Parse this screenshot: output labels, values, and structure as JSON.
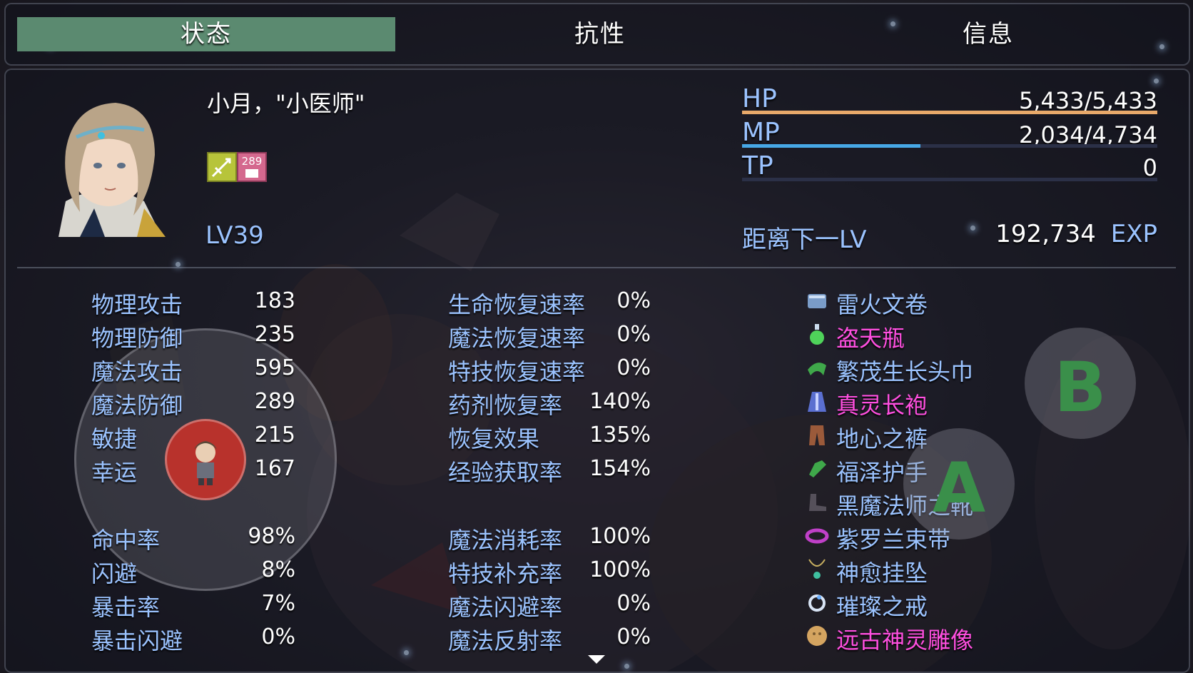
{
  "tabs": [
    {
      "label": "状态",
      "active": true
    },
    {
      "label": "抗性",
      "active": false
    },
    {
      "label": "信息",
      "active": false
    }
  ],
  "character": {
    "name": "小月，\"小医师\"",
    "state_badge": "289",
    "level": "LV39"
  },
  "gauges": {
    "hp": {
      "label": "HP",
      "value": "5,433/5,433",
      "fill": 1.0,
      "color": "#e8a96a"
    },
    "mp": {
      "label": "MP",
      "value": "2,034/4,734",
      "fill": 0.43,
      "color": "#47a8e6"
    },
    "tp": {
      "label": "TP",
      "value": "0",
      "fill": 0.0,
      "color": "#6b7cc8"
    }
  },
  "exp": {
    "label": "距离下一LV",
    "value": "192,734",
    "unit": "EXP"
  },
  "base_stats": [
    {
      "label": "物理攻击",
      "value": "183"
    },
    {
      "label": "物理防御",
      "value": "235"
    },
    {
      "label": "魔法攻击",
      "value": "595"
    },
    {
      "label": "魔法防御",
      "value": "289"
    },
    {
      "label": "敏捷",
      "value": "215"
    },
    {
      "label": "幸运",
      "value": "167"
    }
  ],
  "rate_stats": [
    {
      "label": "命中率",
      "value": "98%"
    },
    {
      "label": "闪避",
      "value": "8%"
    },
    {
      "label": "暴击率",
      "value": "7%"
    },
    {
      "label": "暴击闪避",
      "value": "0%"
    }
  ],
  "recovery_stats": [
    {
      "label": "生命恢复速率",
      "value": "0%"
    },
    {
      "label": "魔法恢复速率",
      "value": "0%"
    },
    {
      "label": "特技恢复速率",
      "value": "0%"
    },
    {
      "label": "药剂恢复率",
      "value": "140%"
    },
    {
      "label": "恢复效果",
      "value": "135%"
    },
    {
      "label": "经验获取率",
      "value": "154%"
    }
  ],
  "special_stats": [
    {
      "label": "魔法消耗率",
      "value": "100%"
    },
    {
      "label": "特技补充率",
      "value": "100%"
    },
    {
      "label": "魔法闪避率",
      "value": "0%"
    },
    {
      "label": "魔法反射率",
      "value": "0%"
    }
  ],
  "equipment": [
    {
      "name": "雷火文卷",
      "color": "#9bc3ff",
      "icon": "scroll-icon"
    },
    {
      "name": "盗天瓶",
      "color": "#ff4fe0",
      "icon": "potion-icon"
    },
    {
      "name": "繁茂生长头巾",
      "color": "#9bc3ff",
      "icon": "headband-icon"
    },
    {
      "name": "真灵长袍",
      "color": "#ff4fe0",
      "icon": "robe-icon"
    },
    {
      "name": "地心之裤",
      "color": "#9bc3ff",
      "icon": "pants-icon"
    },
    {
      "name": "福泽护手",
      "color": "#9bc3ff",
      "icon": "gauntlet-icon"
    },
    {
      "name": "黑魔法师之靴",
      "color": "#9bc3ff",
      "icon": "boots-icon"
    },
    {
      "name": "紫罗兰束带",
      "color": "#9bc3ff",
      "icon": "belt-icon"
    },
    {
      "name": "神愈挂坠",
      "color": "#9bc3ff",
      "icon": "pendant-icon"
    },
    {
      "name": "璀璨之戒",
      "color": "#9bc3ff",
      "icon": "ring-icon"
    },
    {
      "name": "远古神灵雕像",
      "color": "#ff4fe0",
      "icon": "statue-icon"
    }
  ],
  "buttons": {
    "b": "B",
    "a": "A"
  }
}
